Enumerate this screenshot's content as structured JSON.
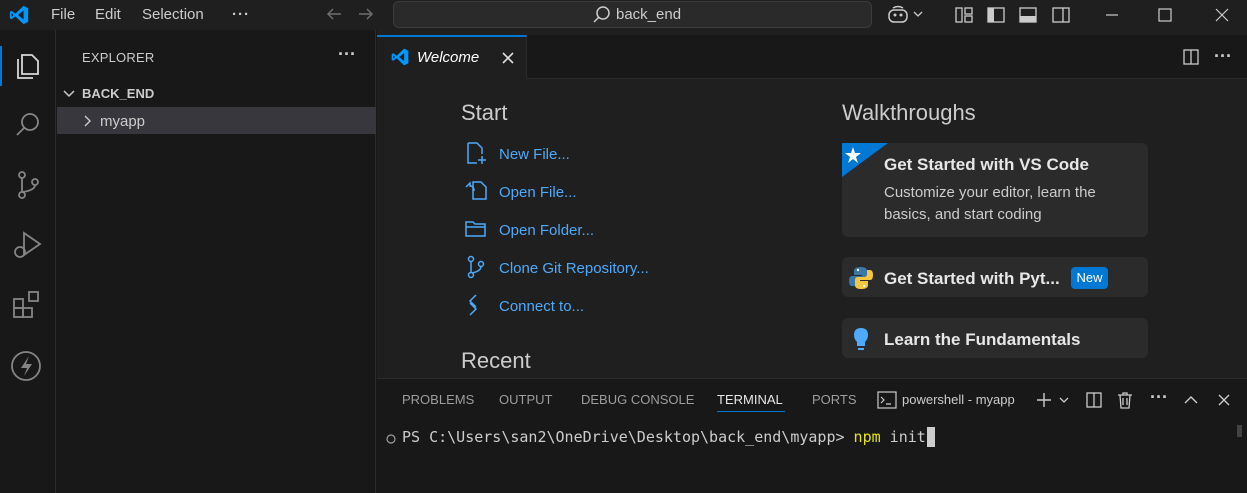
{
  "titlebar": {
    "menus": [
      "File",
      "Edit",
      "Selection"
    ],
    "overflow": "···",
    "search_text": "back_end"
  },
  "activity_icons": [
    "explorer-icon",
    "search-icon",
    "source-control-icon",
    "run-debug-icon",
    "extensions-icon",
    "bolt-icon"
  ],
  "sidebar": {
    "title": "EXPLORER",
    "more": "···",
    "folder": "BACK_END",
    "items": [
      {
        "label": "myapp"
      }
    ]
  },
  "editor": {
    "tab_label": "Welcome",
    "start_title": "Start",
    "start_links": [
      {
        "label": "New File...",
        "icon": "new-file-icon"
      },
      {
        "label": "Open File...",
        "icon": "open-file-icon"
      },
      {
        "label": "Open Folder...",
        "icon": "open-folder-icon"
      },
      {
        "label": "Clone Git Repository...",
        "icon": "git-clone-icon"
      },
      {
        "label": "Connect to...",
        "icon": "remote-connect-icon"
      }
    ],
    "recent_title": "Recent",
    "walkthroughs_title": "Walkthroughs",
    "walkthroughs": [
      {
        "title": "Get Started with VS Code",
        "desc_line1": "Customize your editor, learn the",
        "desc_line2": "basics, and start coding"
      },
      {
        "title": "Get Started with Pyt...",
        "badge": "New"
      },
      {
        "title": "Learn the Fundamentals"
      }
    ]
  },
  "panel": {
    "tabs": [
      "PROBLEMS",
      "OUTPUT",
      "DEBUG CONSOLE",
      "TERMINAL",
      "PORTS"
    ],
    "terminal_name": "powershell - myapp",
    "prompt": "PS C:\\Users\\san2\\OneDrive\\Desktop\\back_end\\myapp> ",
    "command": "npm init"
  },
  "colors": {
    "accent": "#0078d4",
    "link": "#4daafc",
    "background": "#1f1f1f"
  }
}
